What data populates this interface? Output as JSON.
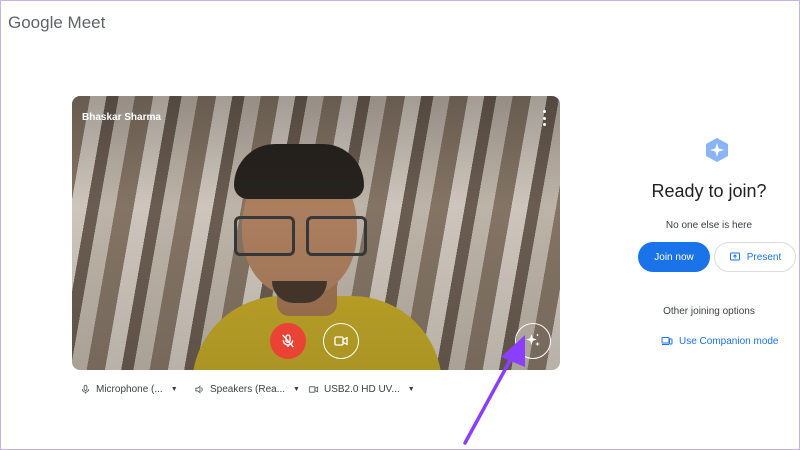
{
  "app": {
    "logo_text": "Google Meet"
  },
  "video": {
    "participant_name": "Bhaskar Sharma",
    "mic_state": "off",
    "controls": [
      "mic-off-icon",
      "camera-icon",
      "effects-sparkle-icon"
    ]
  },
  "devices": {
    "microphone": "Microphone (...",
    "speakers": "Speakers (Rea...",
    "camera": "USB2.0 HD UV..."
  },
  "join_panel": {
    "title": "Ready to join?",
    "status": "No one else is here",
    "join_label": "Join now",
    "present_label": "Present",
    "other_options": "Other joining options",
    "companion_label": "Use Companion mode"
  },
  "colors": {
    "accent": "#1a73e8",
    "mic_off": "#ea4335",
    "annotation_arrow": "#8a3ffc"
  }
}
